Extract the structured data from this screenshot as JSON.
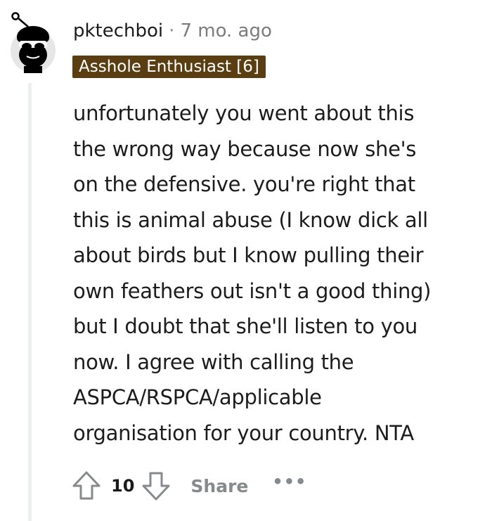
{
  "comment": {
    "author": "pktechboi",
    "separator": "·",
    "timestamp": "7 mo. ago",
    "flair": "Asshole Enthusiast [6]",
    "flair_color": "#5a3e12",
    "avatar_icon": "snoo-sunglasses-avatar-icon",
    "body_lines": [
      "unfortunately you went about this",
      "the wrong way because now she's",
      "on the defensive. you're right that",
      "this is animal abuse (I know dick all",
      "about birds but I know pulling their",
      "own feathers out isn't a good thing)",
      "but I doubt that she'll listen to you",
      "now. I agree with calling the",
      "ASPCA/RSPCA/applicable",
      "organisation for your country. NTA"
    ]
  },
  "actions": {
    "upvote_icon": "upvote-arrow-icon",
    "score": "10",
    "downvote_icon": "downvote-arrow-icon",
    "share_label": "Share",
    "more_label": "•••"
  }
}
